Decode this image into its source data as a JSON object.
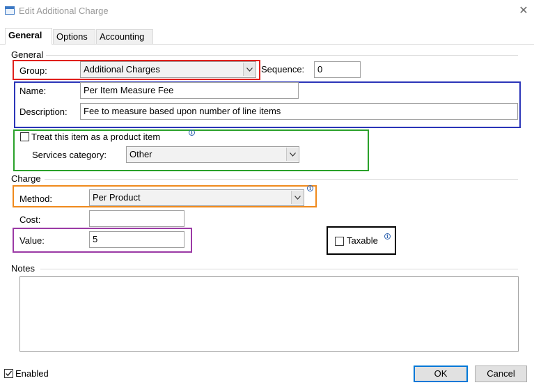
{
  "window": {
    "title": "Edit Additional Charge"
  },
  "tabs": [
    {
      "label": "General",
      "active": true
    },
    {
      "label": "Options",
      "active": false
    },
    {
      "label": "Accounting",
      "active": false
    }
  ],
  "general": {
    "section_label": "General",
    "group_label": "Group:",
    "group_value": "Additional Charges",
    "sequence_label": "Sequence:",
    "sequence_value": "0",
    "name_label": "Name:",
    "name_value": "Per Item Measure Fee",
    "description_label": "Description:",
    "description_value": "Fee to measure based upon number of line items",
    "product_item_label": "Treat this item as a product item",
    "product_item_checked": false,
    "services_category_label": "Services category:",
    "services_category_value": "Other"
  },
  "charge": {
    "section_label": "Charge",
    "method_label": "Method:",
    "method_value": "Per Product",
    "cost_label": "Cost:",
    "cost_value": "",
    "value_label": "Value:",
    "value_value": "5",
    "taxable_label": "Taxable",
    "taxable_checked": false
  },
  "notes": {
    "section_label": "Notes",
    "value": ""
  },
  "footer": {
    "enabled_label": "Enabled",
    "enabled_checked": true,
    "ok_label": "OK",
    "cancel_label": "Cancel"
  },
  "colors": {
    "group_box": "#e0201c",
    "name_desc_box": "#2b35b8",
    "product_box": "#2aa12a",
    "method_box": "#f08a1c",
    "value_box": "#9b3aa5",
    "taxable_box": "#000000",
    "ok_border": "#0078d7"
  }
}
